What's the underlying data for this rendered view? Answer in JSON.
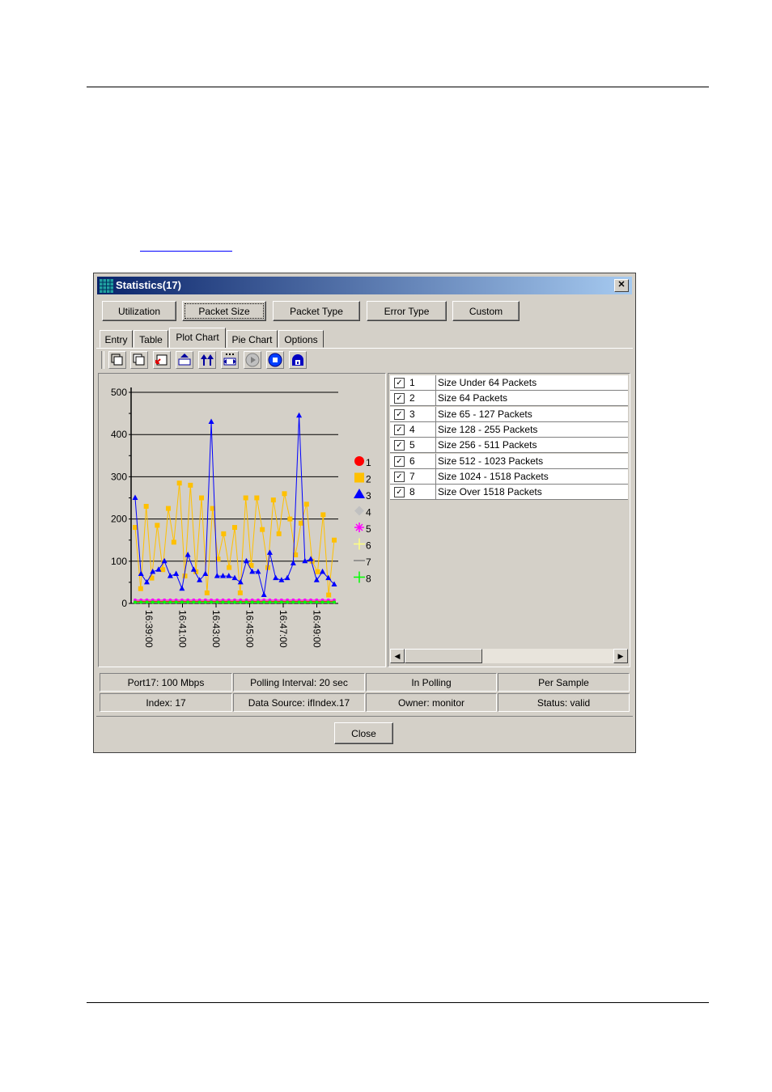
{
  "window": {
    "title": "Statistics(17)",
    "close_glyph": "✕"
  },
  "top_buttons": [
    {
      "label": "Utilization"
    },
    {
      "label": "Packet Size"
    },
    {
      "label": "Packet Type"
    },
    {
      "label": "Error Type"
    },
    {
      "label": "Custom"
    }
  ],
  "selected_top_button": "Packet Size",
  "tabs": [
    {
      "label": "Entry"
    },
    {
      "label": "Table"
    },
    {
      "label": "Plot Chart"
    },
    {
      "label": "Pie Chart"
    },
    {
      "label": "Options"
    }
  ],
  "active_tab": "Plot Chart",
  "toolbar_icons": [
    "stack-icon",
    "layers-icon",
    "checkmark-icon",
    "fit-width-icon",
    "arrows-up-icon",
    "grid-expand-icon",
    "play-icon",
    "stop-icon",
    "lock-network-icon"
  ],
  "legend": [
    {
      "id": "1",
      "color": "#ff0000",
      "marker": "circle"
    },
    {
      "id": "2",
      "color": "#ffc000",
      "marker": "square"
    },
    {
      "id": "3",
      "color": "#0000ff",
      "marker": "triangle"
    },
    {
      "id": "4",
      "color": "#c0c0c0",
      "marker": "diamond"
    },
    {
      "id": "5",
      "color": "#ff00ff",
      "marker": "star"
    },
    {
      "id": "6",
      "color": "#ffff80",
      "marker": "plus"
    },
    {
      "id": "7",
      "color": "#808080",
      "marker": "line"
    },
    {
      "id": "8",
      "color": "#00ff00",
      "marker": "plus"
    }
  ],
  "series_list": [
    {
      "id": "1",
      "label": "Size Under 64 Packets",
      "checked": true
    },
    {
      "id": "2",
      "label": "Size 64 Packets",
      "checked": true
    },
    {
      "id": "3",
      "label": "Size 65 - 127 Packets",
      "checked": true
    },
    {
      "id": "4",
      "label": "Size 128 - 255 Packets",
      "checked": true
    },
    {
      "id": "5",
      "label": "Size 256 - 511 Packets",
      "checked": true
    },
    {
      "id": "6",
      "label": "Size 512 - 1023 Packets",
      "checked": true
    },
    {
      "id": "7",
      "label": "Size 1024 - 1518 Packets",
      "checked": true
    },
    {
      "id": "8",
      "label": "Size Over 1518 Packets",
      "checked": true
    }
  ],
  "status": {
    "port": "Port17: 100 Mbps",
    "polling": "Polling Interval: 20 sec",
    "in_polling": "In Polling",
    "per_sample": "Per Sample",
    "index": "Index: 17",
    "data_source": "Data Source: ifIndex.17",
    "owner": "Owner: monitor",
    "status": "Status: valid"
  },
  "close_label": "Close",
  "chart_data": {
    "type": "line",
    "ylim": [
      0,
      500
    ],
    "yticks": [
      "0",
      "100",
      "200",
      "300",
      "400",
      "500"
    ],
    "xticks": [
      "16:39:00",
      "16:41:00",
      "16:43:00",
      "16:45:00",
      "16:47:00",
      "16:49:00"
    ],
    "series": [
      {
        "id": "2",
        "color": "#ffc000",
        "values": [
          180,
          35,
          230,
          60,
          185,
          80,
          225,
          145,
          285,
          65,
          280,
          75,
          250,
          25,
          225,
          105,
          165,
          85,
          180,
          25,
          250,
          90,
          250,
          175,
          85,
          245,
          165,
          260,
          200,
          115,
          190,
          235,
          100,
          75,
          210,
          20,
          150
        ]
      },
      {
        "id": "3",
        "color": "#0000ff",
        "values": [
          250,
          70,
          50,
          75,
          80,
          100,
          65,
          70,
          35,
          115,
          80,
          55,
          70,
          430,
          65,
          65,
          65,
          60,
          50,
          100,
          75,
          75,
          20,
          120,
          60,
          55,
          60,
          95,
          445,
          100,
          105,
          55,
          75,
          60,
          45
        ]
      },
      {
        "id": "1",
        "color": "#ff0000",
        "values": [
          5,
          5,
          5,
          5,
          5,
          5,
          5,
          5,
          5,
          5,
          5,
          5,
          5,
          5,
          5,
          5,
          5,
          5,
          5,
          5,
          5,
          5,
          5,
          5,
          5,
          5,
          5,
          5,
          5,
          5,
          5,
          5,
          5,
          5,
          5
        ]
      },
      {
        "id": "5",
        "color": "#ff00ff",
        "values": [
          8,
          8,
          8,
          8,
          8,
          8,
          8,
          8,
          8,
          8,
          8,
          8,
          8,
          8,
          8,
          8,
          8,
          8,
          8,
          8,
          8,
          8,
          8,
          8,
          8,
          8,
          8,
          8,
          8,
          8,
          8,
          8,
          8,
          8,
          8
        ]
      },
      {
        "id": "8",
        "color": "#00ff00",
        "values": [
          3,
          3,
          3,
          3,
          3,
          3,
          3,
          3,
          3,
          3,
          3,
          3,
          3,
          3,
          3,
          3,
          3,
          3,
          3,
          3,
          3,
          3,
          3,
          3,
          3,
          3,
          3,
          3,
          3,
          3,
          3,
          3,
          3,
          3,
          3
        ]
      }
    ]
  }
}
